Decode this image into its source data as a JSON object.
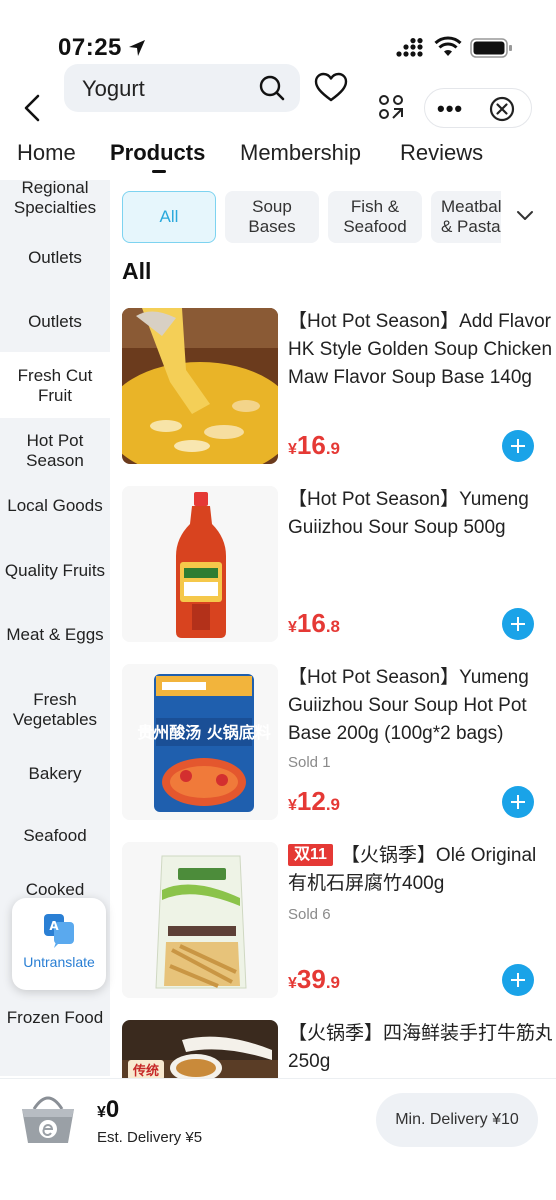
{
  "status_bar": {
    "time": "07:25"
  },
  "search": {
    "query": "Yogurt"
  },
  "tabs": [
    {
      "label": "Home"
    },
    {
      "label": "Products"
    },
    {
      "label": "Membership"
    },
    {
      "label": "Reviews"
    }
  ],
  "sidebar": {
    "items": [
      {
        "label": "Regional Specialties"
      },
      {
        "label": "Outlets"
      },
      {
        "label": "Outlets"
      },
      {
        "label": "Fresh Cut Fruit"
      },
      {
        "label": "Hot Pot Season"
      },
      {
        "label": "Local Goods"
      },
      {
        "label": "Quality Fruits"
      },
      {
        "label": "Meat & Eggs"
      },
      {
        "label": "Fresh Vegetables"
      },
      {
        "label": "Bakery"
      },
      {
        "label": "Seafood"
      },
      {
        "label": "Cooked"
      },
      {
        "label": "Frozen Food"
      }
    ]
  },
  "filters": {
    "chips": [
      {
        "label": "All"
      },
      {
        "label": "Soup Bases"
      },
      {
        "label": "Fish & Seafood"
      },
      {
        "label": "Meatballs & Pasta"
      }
    ]
  },
  "section_title": "All",
  "products": [
    {
      "title": "【Hot Pot Season】Add Flavor HK Style Golden Soup Chicken Maw Flavor Soup Base 140g",
      "currency": "¥",
      "price_int": "16",
      "price_dec": ".9"
    },
    {
      "title": "【Hot Pot Season】Yumeng Guiizhou Sour Soup 500g",
      "currency": "¥",
      "price_int": "16",
      "price_dec": ".8"
    },
    {
      "title": "【Hot Pot Season】Yumeng Guiizhou Sour Soup Hot Pot Base 200g (100g*2 bags)",
      "sold": "Sold 1",
      "currency": "¥",
      "price_int": "12",
      "price_dec": ".9",
      "packet_text": "贵州酸汤 火锅底料"
    },
    {
      "badge": "双11",
      "title": "【火锅季】Olé Original 有机石屏腐竹400g",
      "sold": "Sold 6",
      "currency": "¥",
      "price_int": "39",
      "price_dec": ".9"
    },
    {
      "title": "【火锅季】四海鲜装手打牛筋丸250g",
      "tag": "传统"
    }
  ],
  "untranslate": {
    "label": "Untranslate"
  },
  "cart": {
    "currency": "¥",
    "total": "0",
    "est_delivery": "Est. Delivery ¥5",
    "min_delivery": "Min. Delivery ¥10"
  },
  "colors": {
    "accent": "#1aa3e8",
    "price": "#e53935",
    "chip_active": "#2aa9dc"
  }
}
